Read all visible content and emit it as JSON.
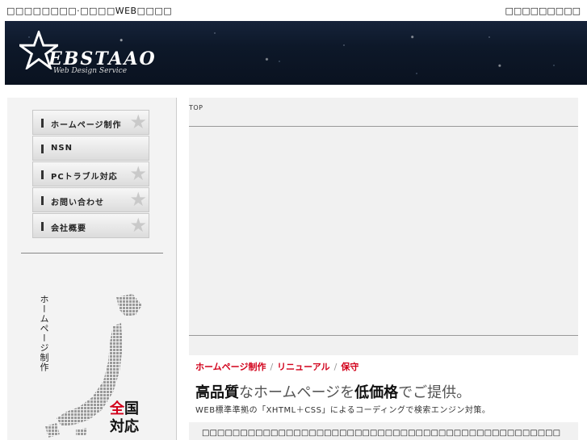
{
  "topbar": {
    "left_text": "□□□□□□□□·□□□□WEB□□□□",
    "right_text": "□□□□□□□□□"
  },
  "header": {
    "logo_text": "EBSTAAO",
    "logo_sub": "Web Design Service"
  },
  "sidebar": {
    "menu": [
      {
        "label": "ホームページ制作"
      },
      {
        "label": "NSN"
      },
      {
        "label": "PCトラブル対応"
      },
      {
        "label": "お問い合わせ"
      },
      {
        "label": "会社概要"
      }
    ],
    "vertical_text": "ホームページ制作",
    "nation_line1_red": "全",
    "nation_line1_rest": "国",
    "nation_line2": "対応"
  },
  "main": {
    "breadcrumb": "TOP",
    "promo": {
      "tag1": "ホームページ制作",
      "tag2": "リニューアル",
      "tag3": "保守",
      "sep": "/",
      "head_part1": "高品質",
      "head_part2": "なホームページを",
      "head_part3": "低価格",
      "head_part4": "でご提供。",
      "description": "WEB標準準拠の「XHTML＋CSS」によるコーディングで検索エンジン対策。"
    },
    "bottom_text": "□□□□□□□□□□□□□□□□□□□□□□□□□□□□□□□□□□□□□□□□□□□□□□□"
  },
  "colors": {
    "accent_red": "#d2001a",
    "banner_dark": "#0d1829",
    "panel_gray": "#f1f1f1"
  }
}
